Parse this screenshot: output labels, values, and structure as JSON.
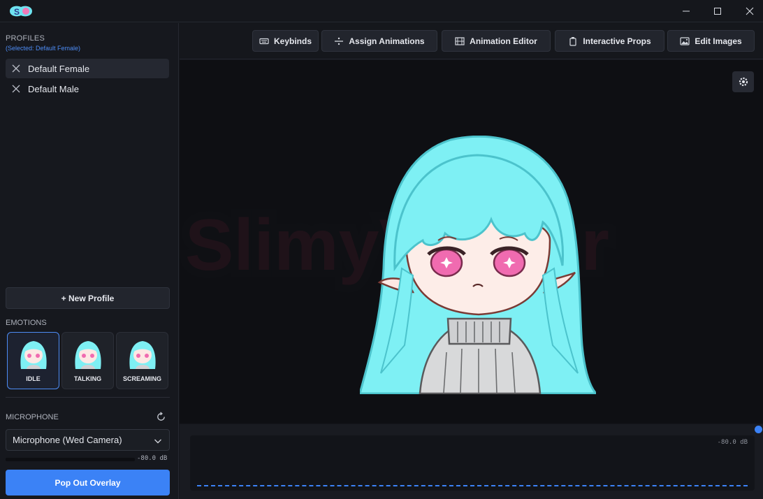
{
  "titlebar": {
    "logo_icon": "slimy-vtuber-logo-icon",
    "minimize_icon": "minimize-icon",
    "maximize_icon": "maximize-icon",
    "close_icon": "close-icon"
  },
  "sidebar": {
    "profiles_heading": "PROFILES",
    "profiles_selected": "(Selected: Default Female)",
    "profiles": [
      {
        "label": "Default Female",
        "active": true
      },
      {
        "label": "Default Male",
        "active": false
      }
    ],
    "new_profile_label": "+ New Profile",
    "emotions_heading": "EMOTIONS",
    "emotions": [
      {
        "label": "IDLE",
        "active": true
      },
      {
        "label": "TALKING",
        "active": false
      },
      {
        "label": "SCREAMING",
        "active": false
      }
    ],
    "microphone_heading": "MICROPHONE",
    "microphone_value": "Microphone (Wed Camera)",
    "microphone_db": "-80.0 dB",
    "popout_label": "Pop Out Overlay"
  },
  "toolbar": {
    "buttons": [
      {
        "label": "Keybinds",
        "icon": "keyboard-icon"
      },
      {
        "label": "Assign Animations",
        "icon": "divide-icon"
      },
      {
        "label": "Animation Editor",
        "icon": "film-icon"
      },
      {
        "label": "Interactive Props",
        "icon": "props-icon"
      },
      {
        "label": "Edit Images",
        "icon": "image-icon"
      }
    ]
  },
  "stage": {
    "settings_icon": "gear-icon"
  },
  "audio": {
    "db_label": "-80.0 dB"
  },
  "colors": {
    "accent": "#3b82f6",
    "background": "#14161b",
    "hair": "#7ef0f4",
    "eyes": "#f06bb0"
  }
}
